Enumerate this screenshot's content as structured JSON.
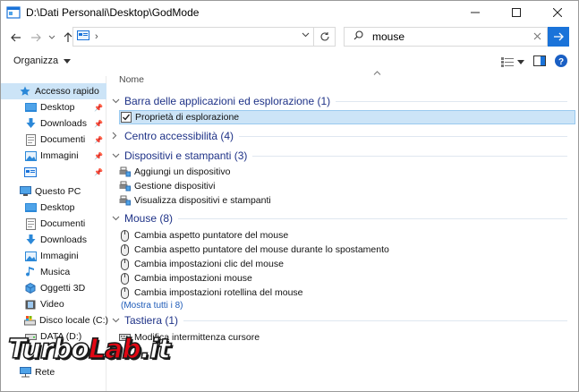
{
  "window": {
    "title": "D:\\Dati Personali\\Desktop\\GodMode"
  },
  "address": {
    "chevron": "›"
  },
  "search": {
    "value": "mouse"
  },
  "toolbar": {
    "organize_label": "Organizza"
  },
  "nav": {
    "quick_access": "Accesso rapido",
    "quick_items": [
      {
        "label": "Desktop",
        "icon": "desktop-folder-icon"
      },
      {
        "label": "Downloads",
        "icon": "download-arrow-icon"
      },
      {
        "label": "Documenti",
        "icon": "documents-icon"
      },
      {
        "label": "Immagini",
        "icon": "pictures-icon"
      },
      {
        "label": "",
        "icon": "control-panel-icon"
      }
    ],
    "this_pc": "Questo PC",
    "pc_items": [
      {
        "label": "Desktop"
      },
      {
        "label": "Documenti"
      },
      {
        "label": "Downloads"
      },
      {
        "label": "Immagini"
      },
      {
        "label": "Musica"
      },
      {
        "label": "Oggetti 3D"
      },
      {
        "label": "Video"
      },
      {
        "label": "Disco locale (C:)"
      },
      {
        "label": "DATA (D:)"
      }
    ],
    "network": "Rete"
  },
  "content": {
    "column_header": "Nome",
    "groups": [
      {
        "title": "Barra delle applicazioni ed esplorazione (1)",
        "expanded": true,
        "items": [
          "Proprietà di esplorazione"
        ]
      },
      {
        "title": "Centro accessibilità (4)",
        "expanded": false,
        "items": []
      },
      {
        "title": "Dispositivi e stampanti (3)",
        "expanded": true,
        "items": [
          "Aggiungi un dispositivo",
          "Gestione dispositivi",
          "Visualizza dispositivi e stampanti"
        ]
      },
      {
        "title": "Mouse (8)",
        "expanded": true,
        "items": [
          "Cambia aspetto puntatore del mouse",
          "Cambia aspetto puntatore del mouse durante lo spostamento",
          "Cambia impostazioni clic del mouse",
          "Cambia impostazioni mouse",
          "Cambia impostazioni rotellina del mouse"
        ],
        "show_all": "(Mostra tutti i 8)"
      },
      {
        "title": "Tastiera (1)",
        "expanded": true,
        "items": [
          "Modifica intermittenza cursore"
        ]
      }
    ]
  },
  "watermark": {
    "part1": "Turbo",
    "part2": "Lab",
    "part3": ".it"
  },
  "colors": {
    "selection": "#cce4f7",
    "group_text": "#1e3287",
    "go_button": "#1a73d9",
    "brand_red": "#e30613"
  }
}
